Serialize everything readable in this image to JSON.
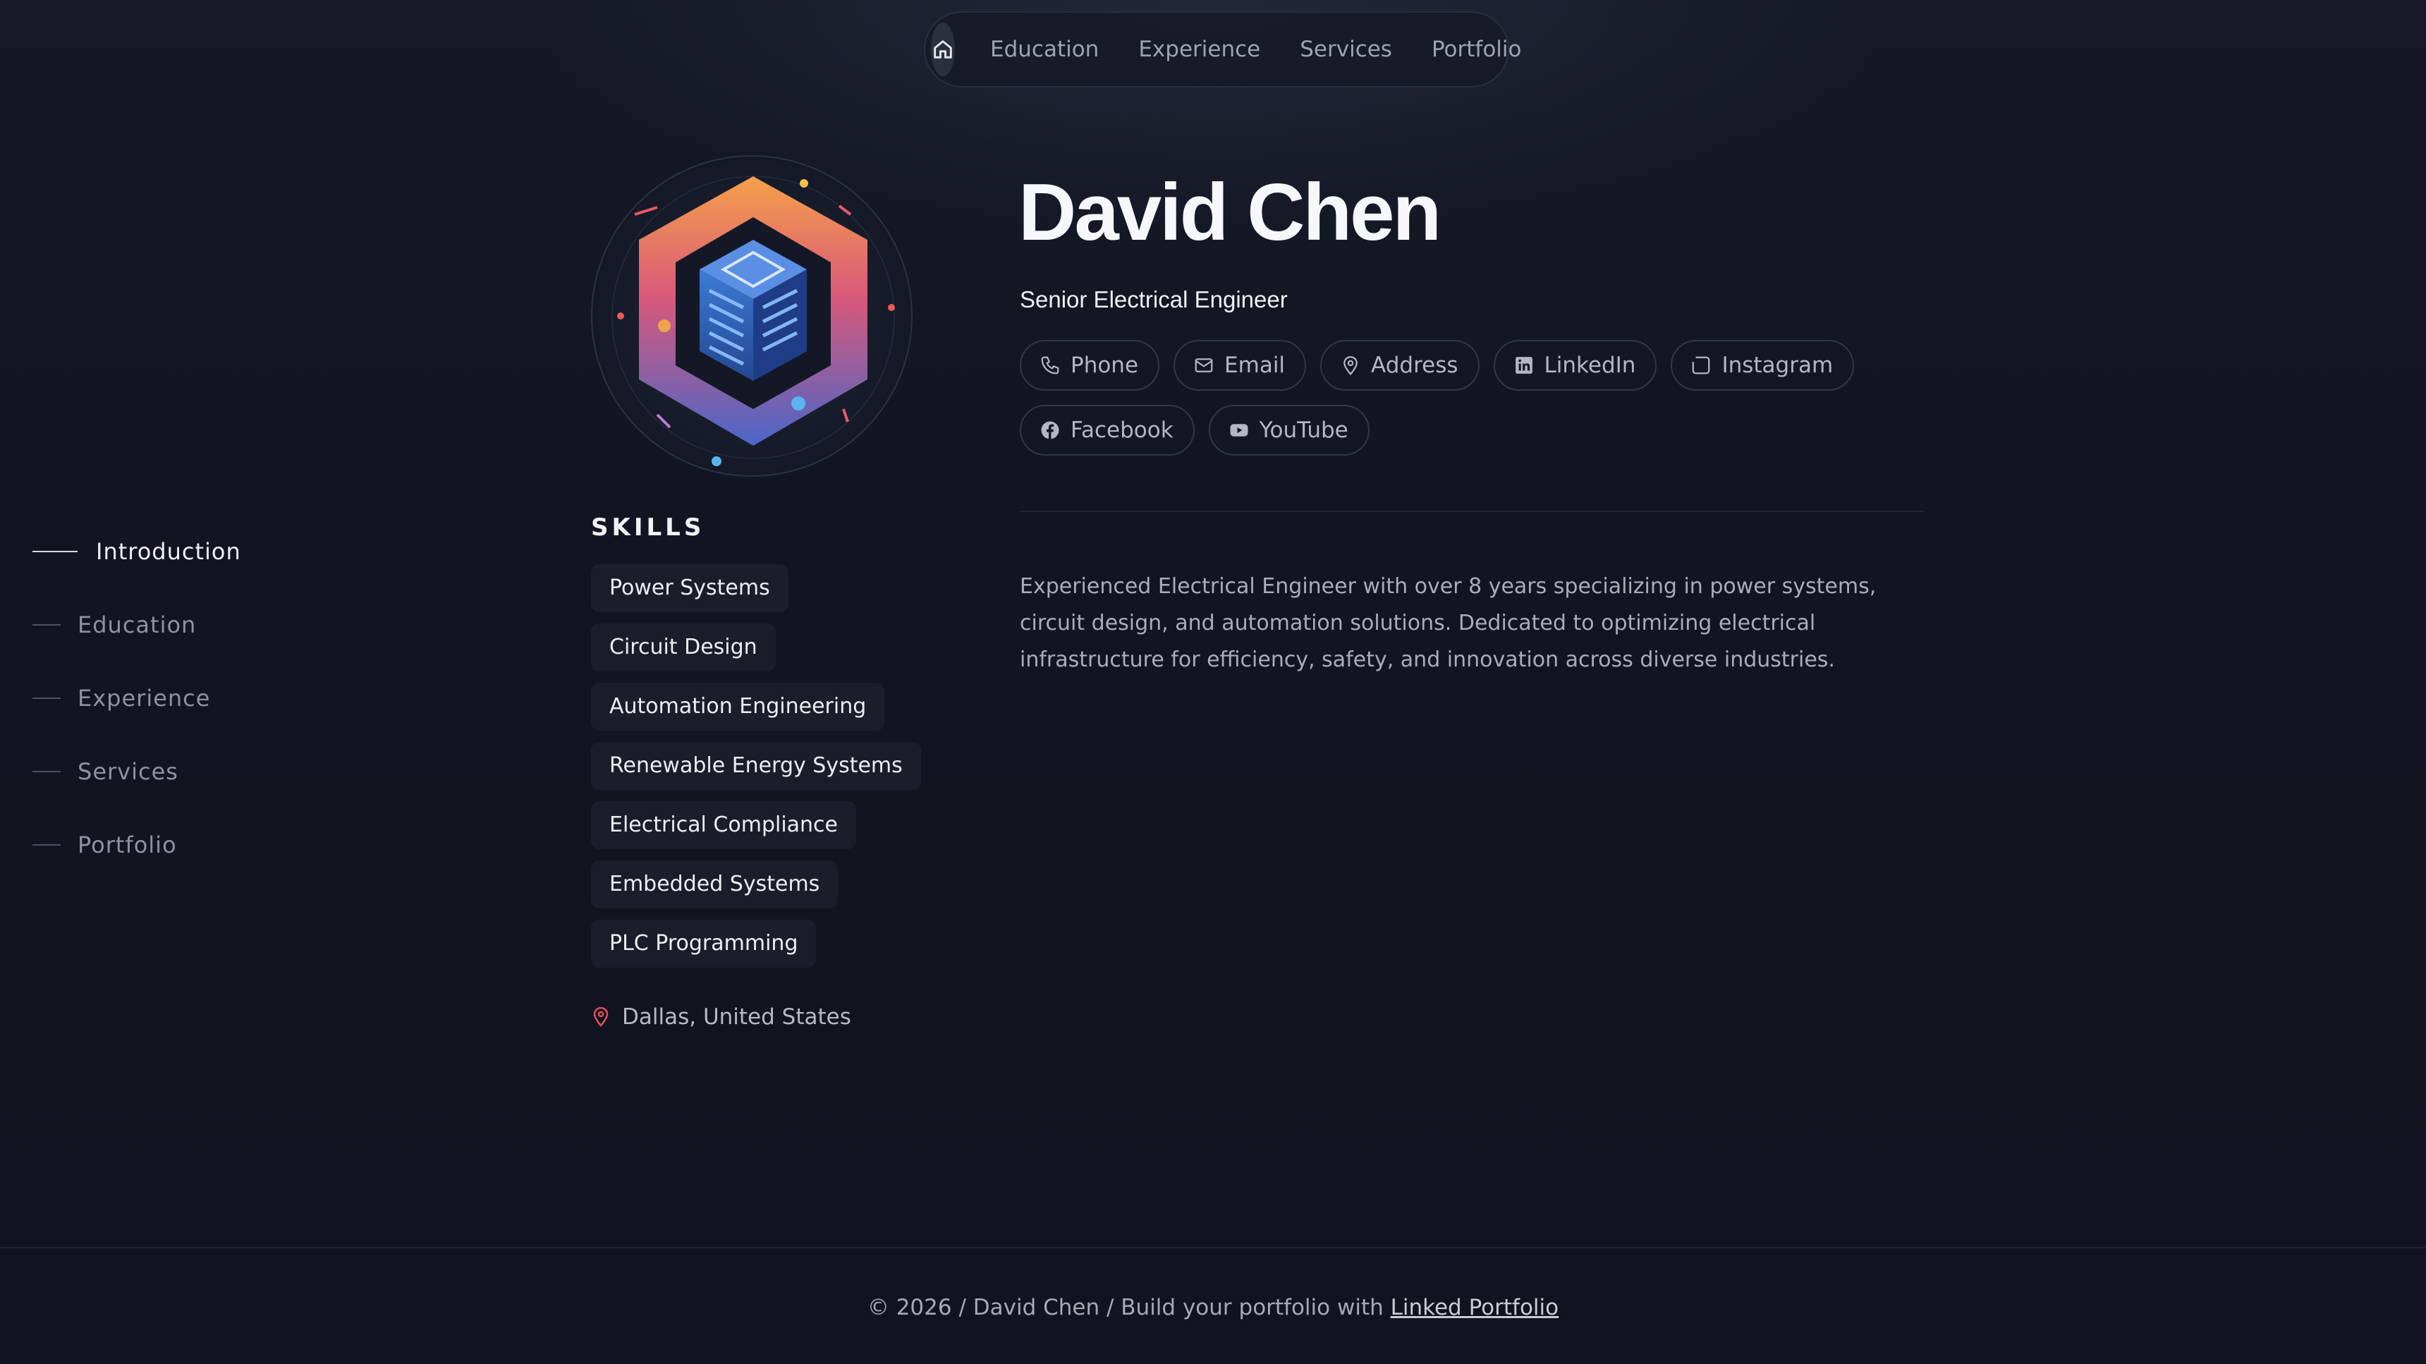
{
  "topnav": {
    "home_icon": "home-icon",
    "items": [
      "Education",
      "Experience",
      "Services",
      "Portfolio"
    ]
  },
  "sidenav": {
    "items": [
      {
        "label": "Introduction",
        "active": true
      },
      {
        "label": "Education",
        "active": false
      },
      {
        "label": "Experience",
        "active": false
      },
      {
        "label": "Services",
        "active": false
      },
      {
        "label": "Portfolio",
        "active": false
      }
    ]
  },
  "profile": {
    "name": "David Chen",
    "role": "Senior Electrical Engineer",
    "bio": "Experienced Electrical Engineer with over 8 years specializing in power systems, circuit design, and automation solutions. Dedicated to optimizing electrical infrastructure for efficiency, safety, and innovation across diverse industries.",
    "location": "Dallas, United States"
  },
  "contacts": {
    "phone": "Phone",
    "email": "Email",
    "address": "Address",
    "linkedin": "LinkedIn",
    "instagram": "Instagram",
    "facebook": "Facebook",
    "youtube": "YouTube"
  },
  "skills": {
    "title": "SKILLS",
    "items": [
      "Power Systems",
      "Circuit Design",
      "Automation Engineering",
      "Renewable Energy Systems",
      "Electrical Compliance",
      "Embedded Systems",
      "PLC Programming"
    ]
  },
  "footer": {
    "text": "© 2026 / David Chen / Build your portfolio with ",
    "link": "Linked Portfolio"
  },
  "colors": {
    "background": "#121521",
    "accent_location": "#e0505e"
  }
}
